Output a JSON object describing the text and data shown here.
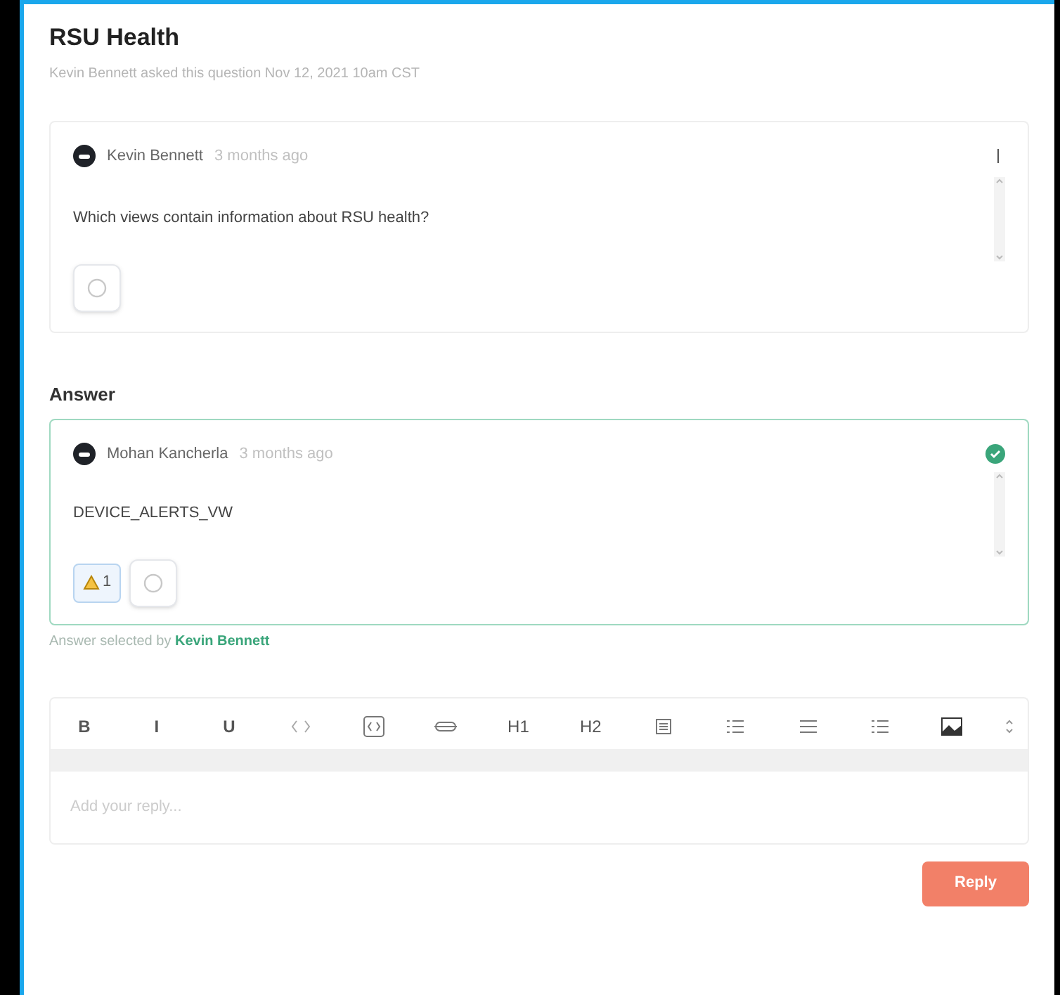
{
  "title": "RSU Health",
  "subtitle": "Kevin Bennett asked this question Nov 12, 2021 10am CST",
  "question": {
    "author": "Kevin Bennett",
    "time": "3 months ago",
    "text": "Which views contain information about RSU health?"
  },
  "answer_heading": "Answer",
  "answer": {
    "author": "Mohan Kancherla",
    "time": "3 months ago",
    "text": "DEVICE_ALERTS_VW",
    "accepted": true,
    "reactions": [
      {
        "count": "1"
      }
    ]
  },
  "selected_by": {
    "prefix": "Answer selected by",
    "name": "Kevin Bennett"
  },
  "toolbar": [
    {
      "kind": "text",
      "label": "B"
    },
    {
      "kind": "text",
      "label": "I"
    },
    {
      "kind": "text",
      "label": "U"
    },
    {
      "kind": "code"
    },
    {
      "kind": "codeblock"
    },
    {
      "kind": "strike"
    },
    {
      "kind": "text",
      "label": "H1"
    },
    {
      "kind": "text",
      "label": "H2"
    },
    {
      "kind": "quote"
    },
    {
      "kind": "ol"
    },
    {
      "kind": "ul"
    },
    {
      "kind": "task"
    },
    {
      "kind": "image"
    }
  ],
  "reply": {
    "placeholder": "Add your reply..."
  },
  "reply_button": "Reply"
}
